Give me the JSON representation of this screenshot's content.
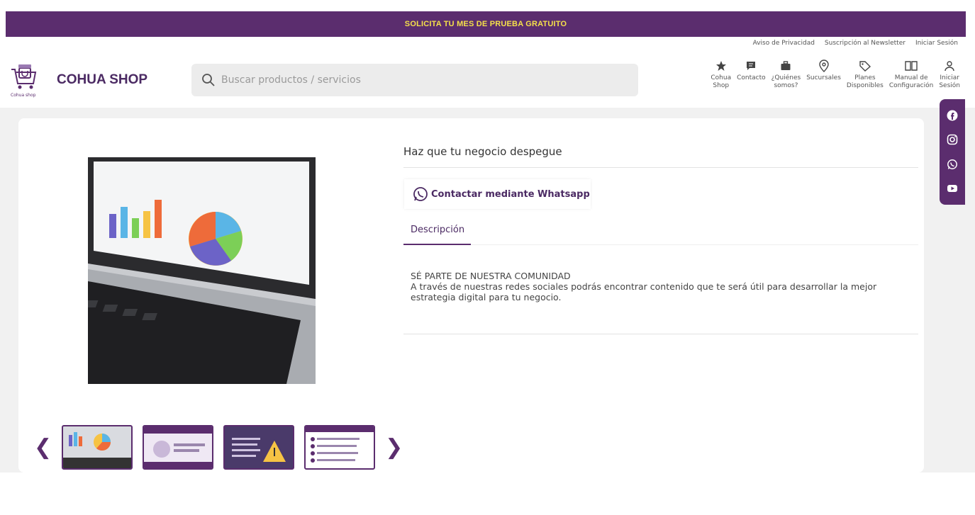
{
  "promo": {
    "text": "SOLICITA TU MES DE PRUEBA GRATUITO"
  },
  "top_links": [
    "Aviso de Privacidad",
    "Suscripción al Newsletter",
    "Iniciar Sesión"
  ],
  "logo": {
    "caption": "Cohua shop"
  },
  "brand": "COHUA SHOP",
  "search": {
    "placeholder": "Buscar productos / servicios"
  },
  "nav": [
    {
      "icon": "star-icon",
      "line1": "Cohua",
      "line2": "Shop"
    },
    {
      "icon": "chat-icon",
      "line1": "Contacto",
      "line2": ""
    },
    {
      "icon": "briefcase-icon",
      "line1": "¿Quiénes",
      "line2": "somos?"
    },
    {
      "icon": "location-pin-icon",
      "line1": "Sucursales",
      "line2": ""
    },
    {
      "icon": "tag-icon",
      "line1": "Planes",
      "line2": "Disponibles"
    },
    {
      "icon": "book-icon",
      "line1": "Manual de",
      "line2": "Configuración"
    },
    {
      "icon": "user-icon",
      "line1": "Iniciar",
      "line2": "Sesión"
    }
  ],
  "product": {
    "title": "Haz que tu negocio despegue",
    "whatsapp_label": "Contactar mediante Whatsapp",
    "tab_label": "Descripción",
    "desc_line1": "SÉ PARTE DE NUESTRA COMUNIDAD",
    "desc_line2": "A través de nuestras redes sociales podrás encontrar contenido que te será útil para desarrollar la mejor estrategia digital para tu negocio."
  },
  "social": [
    "facebook-icon",
    "instagram-icon",
    "whatsapp-icon",
    "youtube-icon"
  ],
  "colors": {
    "primary": "#5b2d6e",
    "promo_text": "#f5e04a",
    "background": "#f1f1f1"
  }
}
